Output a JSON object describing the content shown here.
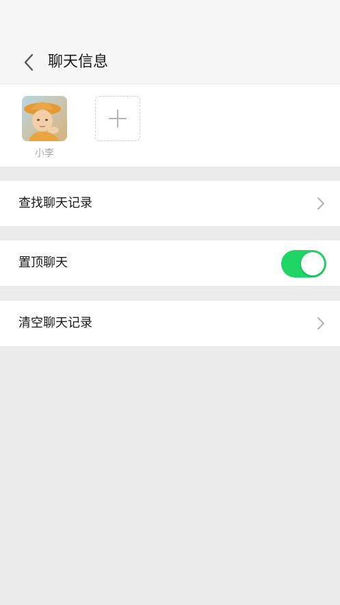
{
  "header": {
    "title": "聊天信息",
    "back_icon": "chevron-left-icon"
  },
  "members": {
    "items": [
      {
        "name": "小李",
        "avatar": "child-with-hat-photo"
      }
    ],
    "add_icon": "plus-icon"
  },
  "settings": {
    "search_history": {
      "label": "查找聊天记录",
      "icon": "chevron-right-icon"
    },
    "pin_chat": {
      "label": "置顶聊天",
      "enabled": true,
      "on_color": "#1fd566"
    },
    "clear_history": {
      "label": "清空聊天记录",
      "icon": "chevron-right-icon"
    }
  }
}
